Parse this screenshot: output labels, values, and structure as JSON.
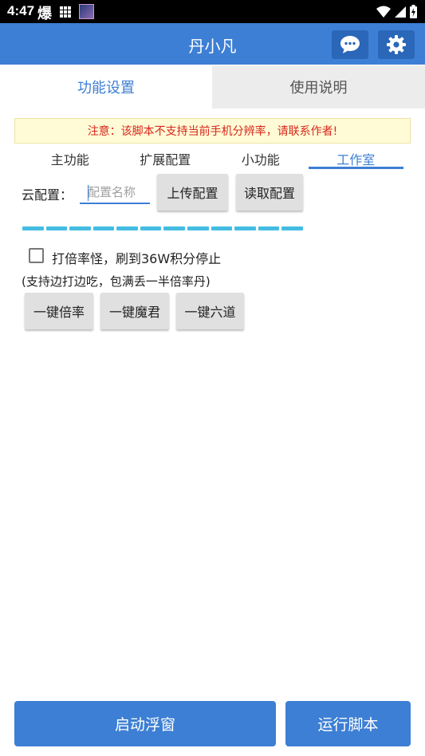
{
  "status_bar": {
    "time": "4:47",
    "notif_char": "爆"
  },
  "app_bar": {
    "title": "丹小凡"
  },
  "top_tabs": [
    {
      "label": "功能设置",
      "active": true
    },
    {
      "label": "使用说明",
      "active": false
    }
  ],
  "notice": "注意：该脚本不支持当前手机分辨率，请联系作者!",
  "sub_tabs": [
    {
      "label": "主功能",
      "active": false
    },
    {
      "label": "扩展配置",
      "active": false
    },
    {
      "label": "小功能",
      "active": false
    },
    {
      "label": "工作室",
      "active": true
    }
  ],
  "cloud_config": {
    "label": "云配置：",
    "placeholder": "配置名称",
    "value": "",
    "upload_label": "上传配置",
    "read_label": "读取配置"
  },
  "option": {
    "checkbox_label": "打倍率怪，刷到36W积分停止",
    "checked": false,
    "hint": "(支持边打边吃，包满丢一半倍率丹)"
  },
  "action_buttons": [
    "一键倍率",
    "一键魔君",
    "一键六道"
  ],
  "bottom": {
    "float_label": "启动浮窗",
    "run_label": "运行脚本"
  },
  "colors": {
    "primary": "#3d7fd4",
    "notice_text": "#d8271c",
    "progress": "#44bde3"
  }
}
